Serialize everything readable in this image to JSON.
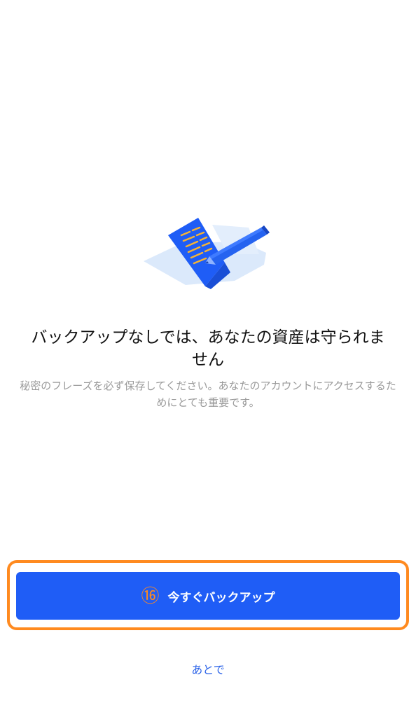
{
  "onboarding": {
    "illustration_icon": "document-pencil-icon",
    "title": "バックアップなしでは、あなたの資産は守られません",
    "subtitle": "秘密のフレーズを必ず保存してください。あなたのアカウントにアクセスするためにとても重要です。"
  },
  "actions": {
    "step_number": "⑯",
    "backup_now_label": "今すぐバックアップ",
    "later_label": "あとで"
  },
  "colors": {
    "primary": "#1f5df6",
    "highlight": "#ff8a1f",
    "link": "#2b63e8"
  }
}
